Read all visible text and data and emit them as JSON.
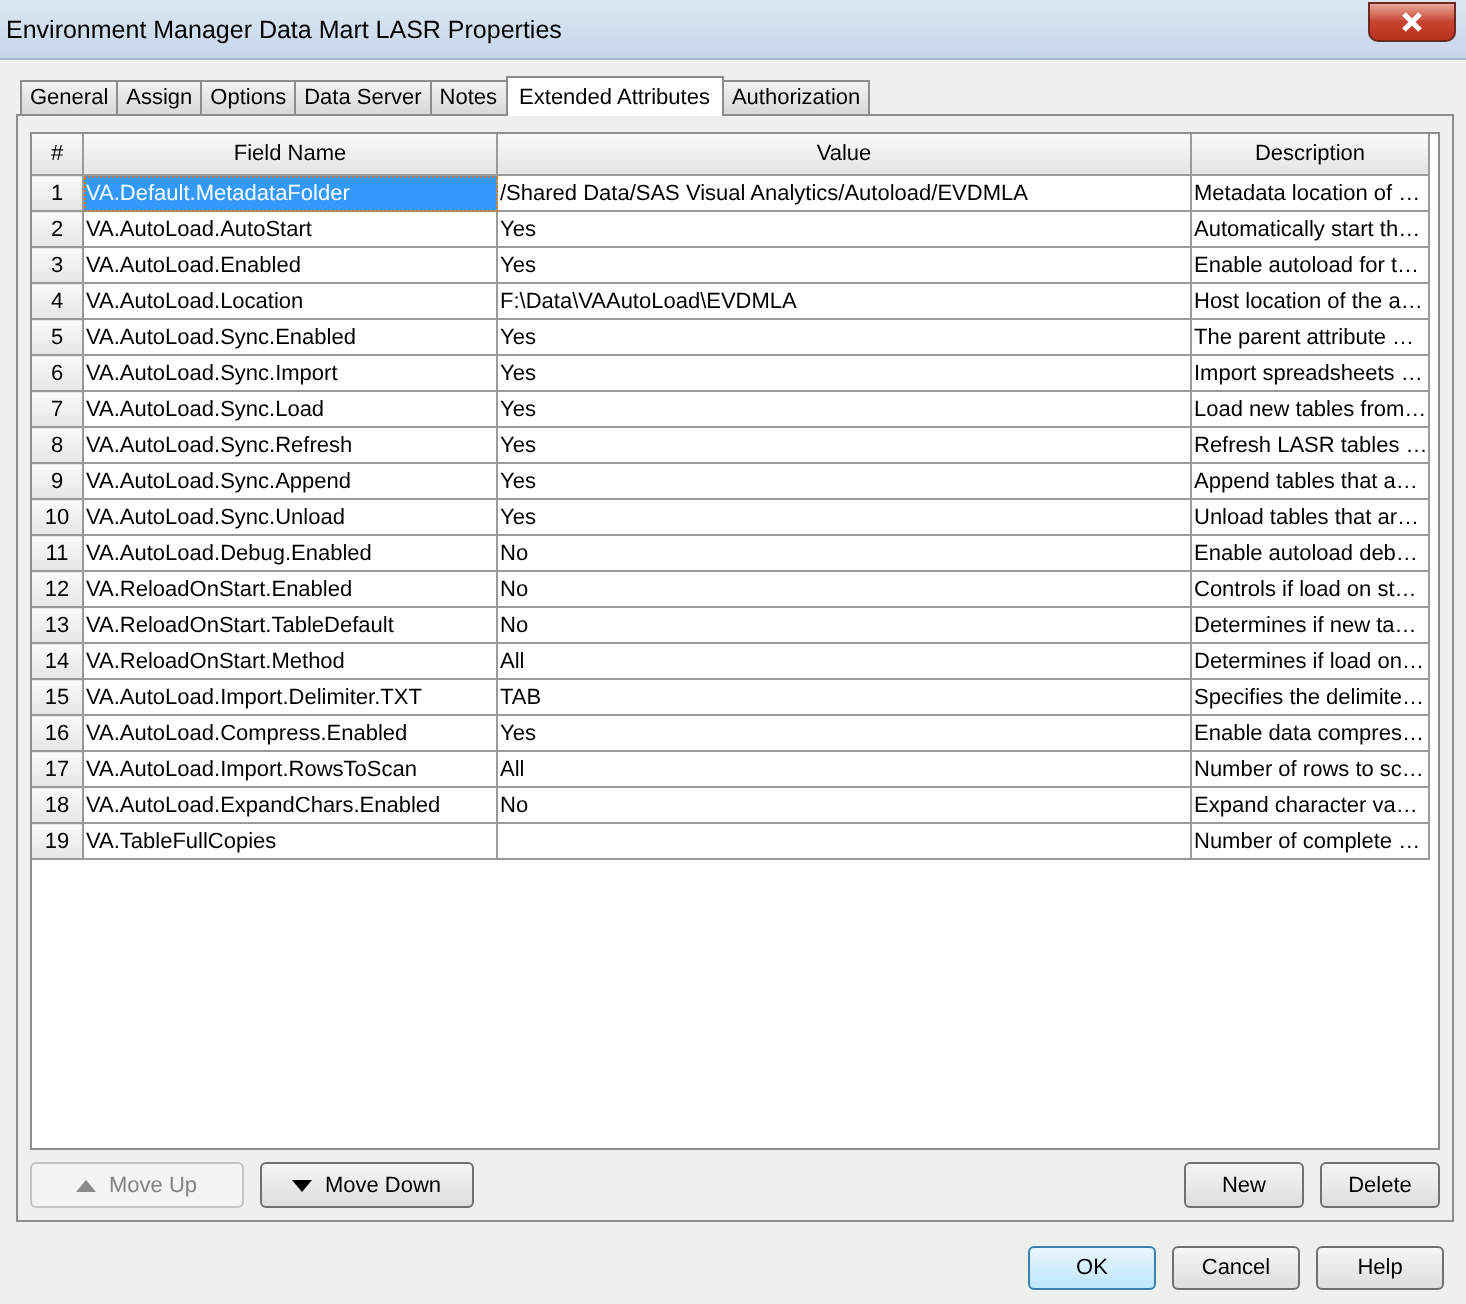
{
  "window": {
    "title": "Environment Manager Data Mart LASR Properties"
  },
  "tabs": [
    {
      "label": "General",
      "selected": false
    },
    {
      "label": "Assign",
      "selected": false
    },
    {
      "label": "Options",
      "selected": false
    },
    {
      "label": "Data Server",
      "selected": false
    },
    {
      "label": "Notes",
      "selected": false
    },
    {
      "label": "Extended Attributes",
      "selected": true
    },
    {
      "label": "Authorization",
      "selected": false
    }
  ],
  "table": {
    "columns": [
      "#",
      "Field Name",
      "Value",
      "Description"
    ],
    "rows": [
      {
        "number": "1",
        "field_name": "VA.Default.MetadataFolder",
        "value": "/Shared Data/SAS Visual Analytics/Autoload/EVDMLA",
        "description": "Metadata location of …",
        "selected": true
      },
      {
        "number": "2",
        "field_name": "VA.AutoLoad.AutoStart",
        "value": "Yes",
        "description": "Automatically start th…",
        "selected": false
      },
      {
        "number": "3",
        "field_name": "VA.AutoLoad.Enabled",
        "value": "Yes",
        "description": "Enable autoload for t…",
        "selected": false
      },
      {
        "number": "4",
        "field_name": "VA.AutoLoad.Location",
        "value": "F:\\Data\\VAAutoLoad\\EVDMLA",
        "description": "Host location of the a…",
        "selected": false
      },
      {
        "number": "5",
        "field_name": "VA.AutoLoad.Sync.Enabled",
        "value": "Yes",
        "description": "The parent attribute …",
        "selected": false
      },
      {
        "number": "6",
        "field_name": "VA.AutoLoad.Sync.Import",
        "value": "Yes",
        "description": "Import spreadsheets …",
        "selected": false
      },
      {
        "number": "7",
        "field_name": "VA.AutoLoad.Sync.Load",
        "value": "Yes",
        "description": "Load new tables from…",
        "selected": false
      },
      {
        "number": "8",
        "field_name": "VA.AutoLoad.Sync.Refresh",
        "value": "Yes",
        "description": "Refresh LASR tables …",
        "selected": false
      },
      {
        "number": "9",
        "field_name": "VA.AutoLoad.Sync.Append",
        "value": "Yes",
        "description": "Append tables that a…",
        "selected": false
      },
      {
        "number": "10",
        "field_name": "VA.AutoLoad.Sync.Unload",
        "value": "Yes",
        "description": "Unload tables that ar…",
        "selected": false
      },
      {
        "number": "11",
        "field_name": "VA.AutoLoad.Debug.Enabled",
        "value": "No",
        "description": "Enable autoload deb…",
        "selected": false
      },
      {
        "number": "12",
        "field_name": "VA.ReloadOnStart.Enabled",
        "value": "No",
        "description": "Controls if load on st…",
        "selected": false
      },
      {
        "number": "13",
        "field_name": "VA.ReloadOnStart.TableDefault",
        "value": "No",
        "description": "Determines if new ta…",
        "selected": false
      },
      {
        "number": "14",
        "field_name": "VA.ReloadOnStart.Method",
        "value": "All",
        "description": "Determines if load on…",
        "selected": false
      },
      {
        "number": "15",
        "field_name": "VA.AutoLoad.Import.Delimiter.TXT",
        "value": "TAB",
        "description": "Specifies the delimite…",
        "selected": false
      },
      {
        "number": "16",
        "field_name": "VA.AutoLoad.Compress.Enabled",
        "value": "Yes",
        "description": "Enable data compres…",
        "selected": false
      },
      {
        "number": "17",
        "field_name": "VA.AutoLoad.Import.RowsToScan",
        "value": "All",
        "description": "Number of rows to sc…",
        "selected": false
      },
      {
        "number": "18",
        "field_name": "VA.AutoLoad.ExpandChars.Enabled",
        "value": "No",
        "description": "Expand character va…",
        "selected": false
      },
      {
        "number": "19",
        "field_name": "VA.TableFullCopies",
        "value": "",
        "description": "Number of complete …",
        "selected": false
      }
    ]
  },
  "row_buttons": [
    {
      "label": "Move Up",
      "kind": "up",
      "disabled": true
    },
    {
      "label": "Move Down",
      "kind": "down",
      "disabled": false
    }
  ],
  "edit_buttons": [
    {
      "label": "New",
      "disabled": false
    },
    {
      "label": "Delete",
      "disabled": false
    }
  ],
  "dialog_buttons": [
    {
      "label": "OK",
      "default": true
    },
    {
      "label": "Cancel",
      "default": false
    },
    {
      "label": "Help",
      "default": false
    }
  ]
}
